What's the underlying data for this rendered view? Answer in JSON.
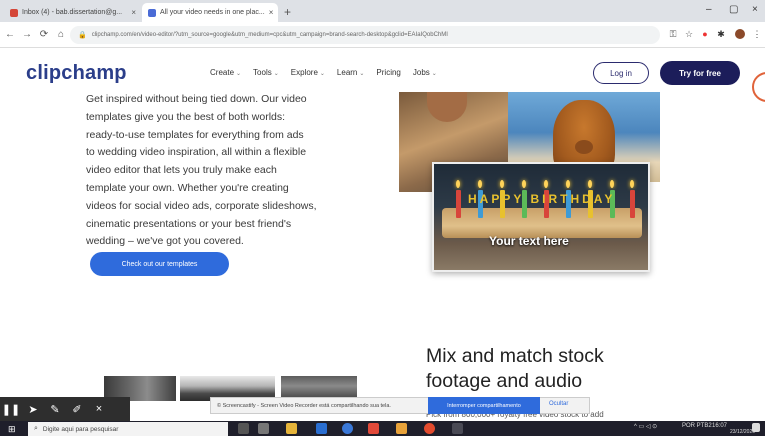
{
  "browser": {
    "tabs": [
      {
        "label": "Inbox (4) - bab.dissertation@g...",
        "active": false,
        "favicon_color": "#d44638"
      },
      {
        "label": "All your video needs in one plac...",
        "active": true,
        "favicon_color": "#4a6bd6"
      }
    ],
    "new_tab": "+",
    "window_controls": [
      "–",
      "▢",
      "×"
    ],
    "nav": {
      "back": "←",
      "forward": "→",
      "reload": "⟳",
      "home": "⌂"
    },
    "url": "clipchamp.com/en/video-editor/?utm_source=google&utm_medium=cpc&utm_campaign=brand-search-desktop&gclid=EAIaIQobChMI",
    "extension_icons": [
      "key-icon",
      "star-icon",
      "extension-icon",
      "puzzle-icon",
      "profile-icon",
      "menu-icon"
    ]
  },
  "site": {
    "logo": "clipchamp",
    "nav": [
      "Create",
      "Tools",
      "Explore",
      "Learn",
      "Pricing",
      "Jobs"
    ],
    "nav_dropdown": [
      true,
      true,
      true,
      true,
      false,
      true
    ],
    "login_label": "Log in",
    "try_label": "Try for free"
  },
  "content": {
    "body_lines": [
      "Get inspired without being tied down. Our video",
      "templates give you the best of both worlds:",
      "ready-to-use templates for everything from ads",
      "to wedding video inspiration, all within a flexible",
      "video editor that lets you truly make each",
      "template your own. Whether you're creating",
      "videos for social video ads, corporate slideshows,",
      "cinematic presentations or your best friend's",
      "wedding – we've got you covered."
    ],
    "cta_label": "Check out our templates",
    "cake_letters": "HAPPY BIRTHDAY",
    "cake_overlay": "Your text here",
    "mix_title_lines": [
      "Mix and match stock",
      "footage and audio"
    ],
    "mix_sub": "Pick from 800,000+ royalty free video stock to add"
  },
  "recorder": {
    "tools": [
      "pause-icon",
      "pointer-icon",
      "pen-icon",
      "highlighter-icon",
      "close-icon"
    ]
  },
  "download_bar": {
    "text": "© Screencastify - Screen Video Recorder está compartilhando sua tela.",
    "primary": "Interromper compartilhamento",
    "secondary": "Ocultar"
  },
  "taskbar": {
    "search_placeholder": "Digite aqui para pesquisar",
    "tray_text": "POR PTB2",
    "time": "16:07",
    "date": "23/12/2020"
  },
  "colors": {
    "brand_navy": "#2b3e8a",
    "cta_blue": "#2f6bdc",
    "try_bg": "#1c1d5a"
  }
}
